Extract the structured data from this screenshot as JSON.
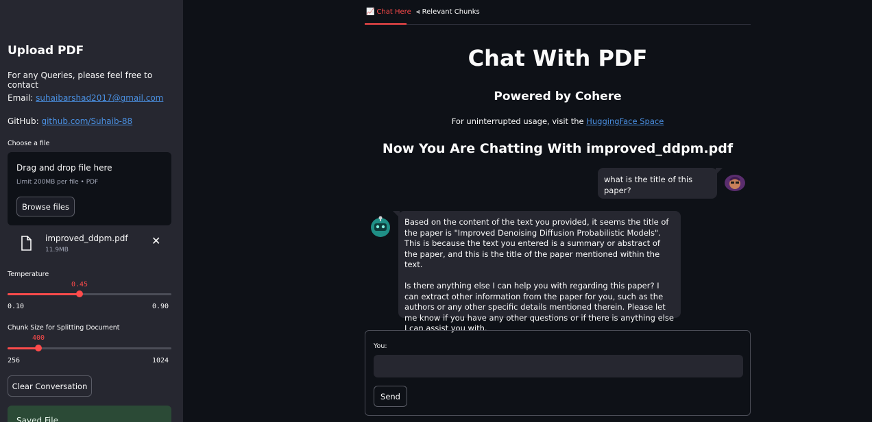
{
  "sidebar": {
    "title": "Upload PDF",
    "contact_text": "For any Queries, please feel free to contact",
    "email_label": "Email:",
    "email": "suhaibarshad2017@gmail.com",
    "github_label": "GitHub:",
    "github": "github.com/Suhaib-88",
    "uploader": {
      "label": "Choose a file",
      "drop_text": "Drag and drop file here",
      "limit_text": "Limit 200MB per file • PDF",
      "browse_label": "Browse files",
      "file_name": "improved_ddpm.pdf",
      "file_size": "11.9MB"
    },
    "temperature": {
      "label": "Temperature",
      "value": "0.45",
      "min": "0.10",
      "max": "0.90",
      "fraction": 0.4375
    },
    "chunk_size": {
      "label": "Chunk Size for Splitting Document",
      "value": "400",
      "min": "256",
      "max": "1024",
      "fraction": 0.1875
    },
    "clear_label": "Clear Conversation",
    "saved_label": "Saved File"
  },
  "tabs": [
    {
      "label": "Chat Here",
      "icon": "chart-icon",
      "active": true
    },
    {
      "label": "Relevant Chunks",
      "icon": "stack-icon",
      "active": false
    }
  ],
  "main": {
    "title": "Chat With PDF",
    "subtitle": "Powered by Cohere",
    "visit_text": "For uninterrupted usage, visit the ",
    "visit_link": "HuggingFace Space",
    "chatting_with": "Now You Are Chatting With improved_ddpm.pdf"
  },
  "messages": [
    {
      "role": "user",
      "text": "what is the title of this paper?"
    },
    {
      "role": "bot",
      "text": "Based on the content of the text you provided, it seems the title of the paper is \"Improved Denoising Diffusion Probabilistic Models\". This is because the text you entered is a summary or abstract of the paper, and this is the title of the paper mentioned within the text.\n\nIs there anything else I can help you with regarding this paper? I can extract other information from the paper for you, such as the authors or any other specific details mentioned therein. Please let me know if you have any other questions or if there is anything else I can assist you with."
    }
  ],
  "form": {
    "label": "You:",
    "input_value": "",
    "send_label": "Send"
  },
  "colors": {
    "accent": "#ff4b4b",
    "link": "#4a90e2",
    "sidebar_bg": "#262730",
    "main_bg": "#0e1117"
  }
}
